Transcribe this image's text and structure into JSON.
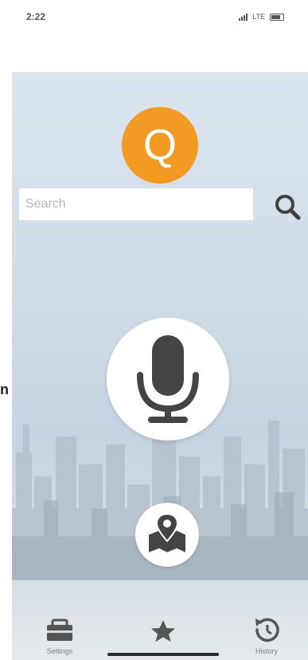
{
  "status_bar": {
    "time": "2:22",
    "network": "LTE"
  },
  "app": {
    "logo_letter": "Q",
    "search": {
      "placeholder": "Search",
      "value": ""
    },
    "edge_text": "n"
  },
  "tab_bar": {
    "tabs": [
      {
        "label": "Settings",
        "icon": "toolbox-icon"
      },
      {
        "label": "",
        "icon": "star-icon"
      },
      {
        "label": "History",
        "icon": "history-icon"
      }
    ]
  },
  "colors": {
    "accent": "#f29a22",
    "icon": "#444444"
  }
}
